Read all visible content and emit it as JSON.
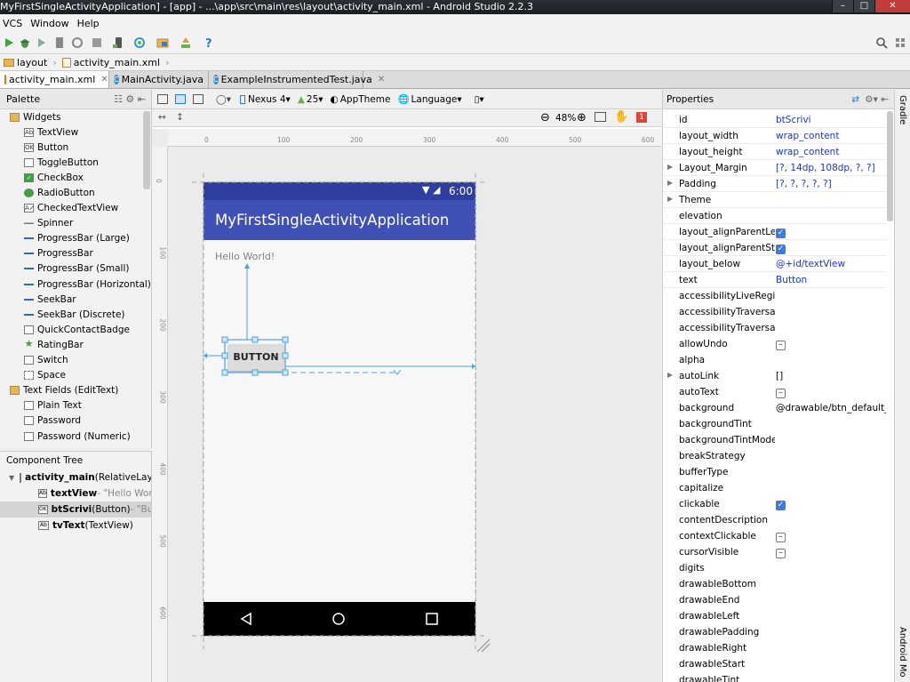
{
  "window": {
    "title": "MyFirstSingleActivityApplication] - [app] - ...\\app\\src\\main\\res\\layout\\activity_main.xml - Android Studio 2.2.3"
  },
  "menu": [
    "VCS",
    "Window",
    "Help"
  ],
  "breadcrumb": {
    "folder": "layout",
    "file": "activity_main.xml"
  },
  "tabs": [
    {
      "label": "activity_main.xml",
      "active": true
    },
    {
      "label": "MainActivity.java",
      "active": false
    },
    {
      "label": "ExampleInstrumentedTest.java",
      "active": false
    }
  ],
  "palette": {
    "title": "Palette",
    "items": [
      {
        "label": "Widgets",
        "kind": "category",
        "icon": "folder-icon"
      },
      {
        "label": "TextView",
        "kind": "item",
        "icon": "textview-icon"
      },
      {
        "label": "Button",
        "kind": "item",
        "icon": "button-icon"
      },
      {
        "label": "ToggleButton",
        "kind": "item",
        "icon": "togglebutton-icon"
      },
      {
        "label": "CheckBox",
        "kind": "item",
        "icon": "checkbox-icon"
      },
      {
        "label": "RadioButton",
        "kind": "item",
        "icon": "radiobutton-icon"
      },
      {
        "label": "CheckedTextView",
        "kind": "item",
        "icon": "checkedtextview-icon"
      },
      {
        "label": "Spinner",
        "kind": "item",
        "icon": "spinner-icon"
      },
      {
        "label": "ProgressBar (Large)",
        "kind": "item",
        "icon": "progressbar-icon"
      },
      {
        "label": "ProgressBar",
        "kind": "item",
        "icon": "progressbar-icon"
      },
      {
        "label": "ProgressBar (Small)",
        "kind": "item",
        "icon": "progressbar-icon"
      },
      {
        "label": "ProgressBar (Horizontal)",
        "kind": "item",
        "icon": "progressbar-icon"
      },
      {
        "label": "SeekBar",
        "kind": "item",
        "icon": "seekbar-icon"
      },
      {
        "label": "SeekBar (Discrete)",
        "kind": "item",
        "icon": "seekbar-icon"
      },
      {
        "label": "QuickContactBadge",
        "kind": "item",
        "icon": "contact-badge-icon"
      },
      {
        "label": "RatingBar",
        "kind": "item",
        "icon": "star-icon"
      },
      {
        "label": "Switch",
        "kind": "item",
        "icon": "switch-icon"
      },
      {
        "label": "Space",
        "kind": "item",
        "icon": "space-icon"
      },
      {
        "label": "Text Fields (EditText)",
        "kind": "category",
        "icon": "folder-icon"
      },
      {
        "label": "Plain Text",
        "kind": "item",
        "icon": "edittext-icon"
      },
      {
        "label": "Password",
        "kind": "item",
        "icon": "edittext-icon"
      },
      {
        "label": "Password (Numeric)",
        "kind": "item",
        "icon": "edittext-icon"
      }
    ]
  },
  "component_tree": {
    "title": "Component Tree",
    "nodes": [
      {
        "name": "activity_main",
        "type": " (RelativeLayout)",
        "value": ""
      },
      {
        "name": "textView",
        "type": "",
        "value": " - \"Hello World!\""
      },
      {
        "name": "btScrivi",
        "type": " (Button)",
        "value": " - \"Button\""
      },
      {
        "name": "tvText",
        "type": " (TextView)",
        "value": ""
      }
    ]
  },
  "design_toolbar": {
    "device": "Nexus 4",
    "api": "25",
    "theme": "AppTheme",
    "language": "Language",
    "zoom": "48%",
    "error_count": "1"
  },
  "ruler": {
    "x_ticks": [
      "0",
      "100",
      "200",
      "300",
      "400",
      "500",
      "600"
    ],
    "y_ticks": [
      "0",
      "100",
      "200",
      "300",
      "400",
      "500",
      "600"
    ]
  },
  "preview": {
    "status_time": "6:00",
    "app_title": "MyFirstSingleActivityApplication",
    "hello_text": "Hello World!",
    "button_text": "BUTTON"
  },
  "properties": {
    "title": "Properties",
    "rows": [
      {
        "name": "id",
        "value": "btScrivi",
        "type": "text"
      },
      {
        "name": "layout_width",
        "value": "wrap_content",
        "type": "text"
      },
      {
        "name": "layout_height",
        "value": "wrap_content",
        "type": "text"
      },
      {
        "name": "Layout_Margin",
        "value": "[?, 14dp, 108dp, ?, ?]",
        "type": "text",
        "expand": true
      },
      {
        "name": "Padding",
        "value": "[?, ?, ?, ?, ?]",
        "type": "text",
        "expand": true
      },
      {
        "name": "Theme",
        "value": "",
        "type": "text",
        "expand": true
      },
      {
        "name": "elevation",
        "value": "",
        "type": "text"
      },
      {
        "name": "layout_alignParentLeft",
        "value": "",
        "type": "check"
      },
      {
        "name": "layout_alignParentStart",
        "value": "",
        "type": "check"
      },
      {
        "name": "layout_below",
        "value": "@+id/textView",
        "type": "text"
      },
      {
        "name": "text",
        "value": "Button",
        "type": "text"
      },
      {
        "name": "accessibilityLiveRegion",
        "value": "",
        "type": "text"
      },
      {
        "name": "accessibilityTraversalAfter",
        "value": "",
        "type": "text"
      },
      {
        "name": "accessibilityTraversalBefore",
        "value": "",
        "type": "text"
      },
      {
        "name": "allowUndo",
        "value": "",
        "type": "tristate"
      },
      {
        "name": "alpha",
        "value": "",
        "type": "text"
      },
      {
        "name": "autoLink",
        "value": "[]",
        "type": "plain",
        "expand": true
      },
      {
        "name": "autoText",
        "value": "",
        "type": "tristate"
      },
      {
        "name": "background",
        "value": "@drawable/btn_default_material",
        "type": "plain"
      },
      {
        "name": "backgroundTint",
        "value": "",
        "type": "text"
      },
      {
        "name": "backgroundTintMode",
        "value": "",
        "type": "text"
      },
      {
        "name": "breakStrategy",
        "value": "",
        "type": "text"
      },
      {
        "name": "bufferType",
        "value": "",
        "type": "text"
      },
      {
        "name": "capitalize",
        "value": "",
        "type": "text"
      },
      {
        "name": "clickable",
        "value": "",
        "type": "check"
      },
      {
        "name": "contentDescription",
        "value": "",
        "type": "text"
      },
      {
        "name": "contextClickable",
        "value": "",
        "type": "tristate"
      },
      {
        "name": "cursorVisible",
        "value": "",
        "type": "tristate"
      },
      {
        "name": "digits",
        "value": "",
        "type": "text"
      },
      {
        "name": "drawableBottom",
        "value": "",
        "type": "text"
      },
      {
        "name": "drawableEnd",
        "value": "",
        "type": "text"
      },
      {
        "name": "drawableLeft",
        "value": "",
        "type": "text"
      },
      {
        "name": "drawablePadding",
        "value": "",
        "type": "text"
      },
      {
        "name": "drawableRight",
        "value": "",
        "type": "text"
      },
      {
        "name": "drawableStart",
        "value": "",
        "type": "text"
      },
      {
        "name": "drawableTint",
        "value": "",
        "type": "text"
      }
    ]
  },
  "side_tools": {
    "top": "Gradle",
    "bottom": "Android Mo"
  },
  "colors": {
    "primary": "#3f51b5",
    "primary_dark": "#303f9f",
    "selection": "#4aa3df",
    "link_value": "#1c36c7",
    "error": "#d9463b"
  }
}
